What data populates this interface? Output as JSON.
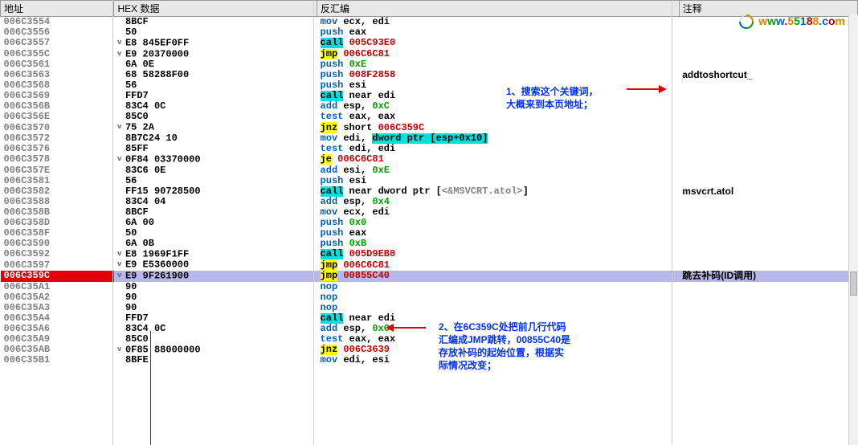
{
  "headers": {
    "addr": "地址",
    "hex": "HEX 数据",
    "asm": "反汇编",
    "comment": "注释"
  },
  "watermark": {
    "text": "www.55188.com",
    "colors": [
      "#e08000",
      "#00a000",
      "#0060c0",
      "#c00000"
    ]
  },
  "note1": {
    "line1": "1、搜索这个关键词，",
    "line2": "大概来到本页地址；"
  },
  "note2": {
    "line1": "2、在6C359C处把前几行代码",
    "line2": "汇编成JMP跳转，00855C40是",
    "line3": "存放补码的起始位置，根据实",
    "line4": "际情况改变；"
  },
  "rows": [
    {
      "addr": "006C3554",
      "hex": "8BCF",
      "asm": [
        {
          "t": "mov ",
          "c": "mn"
        },
        {
          "t": "ecx",
          "c": "reg"
        },
        {
          "t": ", "
        },
        {
          "t": "edi",
          "c": "reg"
        }
      ],
      "expand": ""
    },
    {
      "addr": "006C3556",
      "hex": "50",
      "asm": [
        {
          "t": "push ",
          "c": "mn"
        },
        {
          "t": "eax",
          "c": "reg"
        }
      ],
      "expand": ""
    },
    {
      "addr": "006C3557",
      "hex": "E8 845EF0FF",
      "asm": [
        {
          "t": "call",
          "c": "mn",
          "hl": "cyan"
        },
        {
          "t": " "
        },
        {
          "t": "005C93E0",
          "c": "num-red"
        }
      ],
      "expand": "v"
    },
    {
      "addr": "006C355C",
      "hex": "E9 20370000",
      "asm": [
        {
          "t": "jmp",
          "c": "mn",
          "hl": "yellow"
        },
        {
          "t": " "
        },
        {
          "t": "006C6C81",
          "c": "num-red"
        }
      ],
      "expand": "v"
    },
    {
      "addr": "006C3561",
      "hex": "6A 0E",
      "asm": [
        {
          "t": "push ",
          "c": "mn"
        },
        {
          "t": "0xE",
          "c": "num-green"
        }
      ],
      "expand": ""
    },
    {
      "addr": "006C3563",
      "hex": "68 58288F00",
      "asm": [
        {
          "t": "push ",
          "c": "mn"
        },
        {
          "t": "008F2858",
          "c": "num-red"
        }
      ],
      "expand": "",
      "comment": "addtoshortcut_"
    },
    {
      "addr": "006C3568",
      "hex": "56",
      "asm": [
        {
          "t": "push ",
          "c": "mn"
        },
        {
          "t": "esi",
          "c": "reg"
        }
      ],
      "expand": ""
    },
    {
      "addr": "006C3569",
      "hex": "FFD7",
      "asm": [
        {
          "t": "call",
          "c": "mn",
          "hl": "cyan"
        },
        {
          "t": " near "
        },
        {
          "t": "edi",
          "c": "reg"
        }
      ],
      "expand": ""
    },
    {
      "addr": "006C356B",
      "hex": "83C4 0C",
      "asm": [
        {
          "t": "add ",
          "c": "mn"
        },
        {
          "t": "esp",
          "c": "reg"
        },
        {
          "t": ", "
        },
        {
          "t": "0xC",
          "c": "num-green"
        }
      ],
      "expand": ""
    },
    {
      "addr": "006C356E",
      "hex": "85C0",
      "asm": [
        {
          "t": "test ",
          "c": "mn"
        },
        {
          "t": "eax",
          "c": "reg"
        },
        {
          "t": ", "
        },
        {
          "t": "eax",
          "c": "reg"
        }
      ],
      "expand": ""
    },
    {
      "addr": "006C3570",
      "hex": "75 2A",
      "asm": [
        {
          "t": "jnz",
          "c": "mn",
          "hl": "yellow"
        },
        {
          "t": " short "
        },
        {
          "t": "006C359C",
          "c": "num-red"
        }
      ],
      "expand": "v"
    },
    {
      "addr": "006C3572",
      "hex": "8B7C24 10",
      "asm": [
        {
          "t": "mov ",
          "c": "mn"
        },
        {
          "t": "edi",
          "c": "reg"
        },
        {
          "t": ", "
        },
        {
          "t": "dword ptr [esp+0x10]",
          "c": "reg",
          "hl": "op-cyan"
        }
      ],
      "expand": ""
    },
    {
      "addr": "006C3576",
      "hex": "85FF",
      "asm": [
        {
          "t": "test ",
          "c": "mn"
        },
        {
          "t": "edi",
          "c": "reg"
        },
        {
          "t": ", "
        },
        {
          "t": "edi",
          "c": "reg"
        }
      ],
      "expand": ""
    },
    {
      "addr": "006C3578",
      "hex": "0F84 03370000",
      "asm": [
        {
          "t": "je",
          "c": "mn",
          "hl": "yellow"
        },
        {
          "t": " "
        },
        {
          "t": "006C6C81",
          "c": "num-red"
        }
      ],
      "expand": "v"
    },
    {
      "addr": "006C357E",
      "hex": "83C6 0E",
      "asm": [
        {
          "t": "add ",
          "c": "mn"
        },
        {
          "t": "esi",
          "c": "reg"
        },
        {
          "t": ", "
        },
        {
          "t": "0xE",
          "c": "num-green"
        }
      ],
      "expand": ""
    },
    {
      "addr": "006C3581",
      "hex": "56",
      "asm": [
        {
          "t": "push ",
          "c": "mn"
        },
        {
          "t": "esi",
          "c": "reg"
        }
      ],
      "expand": ""
    },
    {
      "addr": "006C3582",
      "hex": "FF15 90728500",
      "asm": [
        {
          "t": "call",
          "c": "mn",
          "hl": "cyan"
        },
        {
          "t": " near "
        },
        {
          "t": "dword ptr ",
          "c": "reg"
        },
        {
          "t": "[",
          "c": "reg"
        },
        {
          "t": "<&MSVCRT.atol>",
          "c": "sym"
        },
        {
          "t": "]",
          "c": "reg"
        }
      ],
      "expand": "",
      "comment": "msvcrt.atol"
    },
    {
      "addr": "006C3588",
      "hex": "83C4 04",
      "asm": [
        {
          "t": "add ",
          "c": "mn"
        },
        {
          "t": "esp",
          "c": "reg"
        },
        {
          "t": ", "
        },
        {
          "t": "0x4",
          "c": "num-green"
        }
      ],
      "expand": ""
    },
    {
      "addr": "006C358B",
      "hex": "8BCF",
      "asm": [
        {
          "t": "mov ",
          "c": "mn"
        },
        {
          "t": "ecx",
          "c": "reg"
        },
        {
          "t": ", "
        },
        {
          "t": "edi",
          "c": "reg"
        }
      ],
      "expand": ""
    },
    {
      "addr": "006C358D",
      "hex": "6A 00",
      "asm": [
        {
          "t": "push ",
          "c": "mn"
        },
        {
          "t": "0x0",
          "c": "num-green"
        }
      ],
      "expand": ""
    },
    {
      "addr": "006C358F",
      "hex": "50",
      "asm": [
        {
          "t": "push ",
          "c": "mn"
        },
        {
          "t": "eax",
          "c": "reg"
        }
      ],
      "expand": ""
    },
    {
      "addr": "006C3590",
      "hex": "6A 0B",
      "asm": [
        {
          "t": "push ",
          "c": "mn"
        },
        {
          "t": "0xB",
          "c": "num-green"
        }
      ],
      "expand": ""
    },
    {
      "addr": "006C3592",
      "hex": "E8 1969F1FF",
      "asm": [
        {
          "t": "call",
          "c": "mn",
          "hl": "cyan"
        },
        {
          "t": " "
        },
        {
          "t": "005D9EB0",
          "c": "num-red"
        }
      ],
      "expand": "v"
    },
    {
      "addr": "006C3597",
      "hex": "E9 E5360000",
      "asm": [
        {
          "t": "jmp",
          "c": "mn",
          "hl": "yellow"
        },
        {
          "t": " "
        },
        {
          "t": "006C6C81",
          "c": "num-red"
        }
      ],
      "expand": "v"
    },
    {
      "addr": "006C359C",
      "hex": "E9 9F261900",
      "asm": [
        {
          "t": "jmp",
          "c": "mn",
          "hl": "yellow"
        },
        {
          "t": " "
        },
        {
          "t": "00855C40",
          "c": "num-red"
        }
      ],
      "expand": "v",
      "sel": true,
      "comment": "跳去补码(ID调用)"
    },
    {
      "addr": "006C35A1",
      "hex": "90",
      "asm": [
        {
          "t": "nop",
          "c": "mn"
        }
      ],
      "expand": ""
    },
    {
      "addr": "006C35A2",
      "hex": "90",
      "asm": [
        {
          "t": "nop",
          "c": "mn"
        }
      ],
      "expand": ""
    },
    {
      "addr": "006C35A3",
      "hex": "90",
      "asm": [
        {
          "t": "nop",
          "c": "mn"
        }
      ],
      "expand": ""
    },
    {
      "addr": "006C35A4",
      "hex": "FFD7",
      "asm": [
        {
          "t": "call",
          "c": "mn",
          "hl": "cyan"
        },
        {
          "t": " near "
        },
        {
          "t": "edi",
          "c": "reg"
        }
      ],
      "expand": ""
    },
    {
      "addr": "006C35A6",
      "hex": "83C4 0C",
      "asm": [
        {
          "t": "add ",
          "c": "mn"
        },
        {
          "t": "esp",
          "c": "reg"
        },
        {
          "t": ", "
        },
        {
          "t": "0xC",
          "c": "num-green"
        }
      ],
      "expand": ""
    },
    {
      "addr": "006C35A9",
      "hex": "85C0",
      "asm": [
        {
          "t": "test ",
          "c": "mn"
        },
        {
          "t": "eax",
          "c": "reg"
        },
        {
          "t": ", "
        },
        {
          "t": "eax",
          "c": "reg"
        }
      ],
      "expand": ""
    },
    {
      "addr": "006C35AB",
      "hex": "0F85 88000000",
      "asm": [
        {
          "t": "jnz",
          "c": "mn",
          "hl": "yellow"
        },
        {
          "t": " "
        },
        {
          "t": "006C3639",
          "c": "num-red"
        }
      ],
      "expand": "v"
    },
    {
      "addr": "006C35B1",
      "hex": "8BFE",
      "asm": [
        {
          "t": "mov ",
          "c": "mn"
        },
        {
          "t": "edi",
          "c": "reg"
        },
        {
          "t": ", "
        },
        {
          "t": "esi",
          "c": "reg"
        }
      ],
      "expand": ""
    }
  ]
}
